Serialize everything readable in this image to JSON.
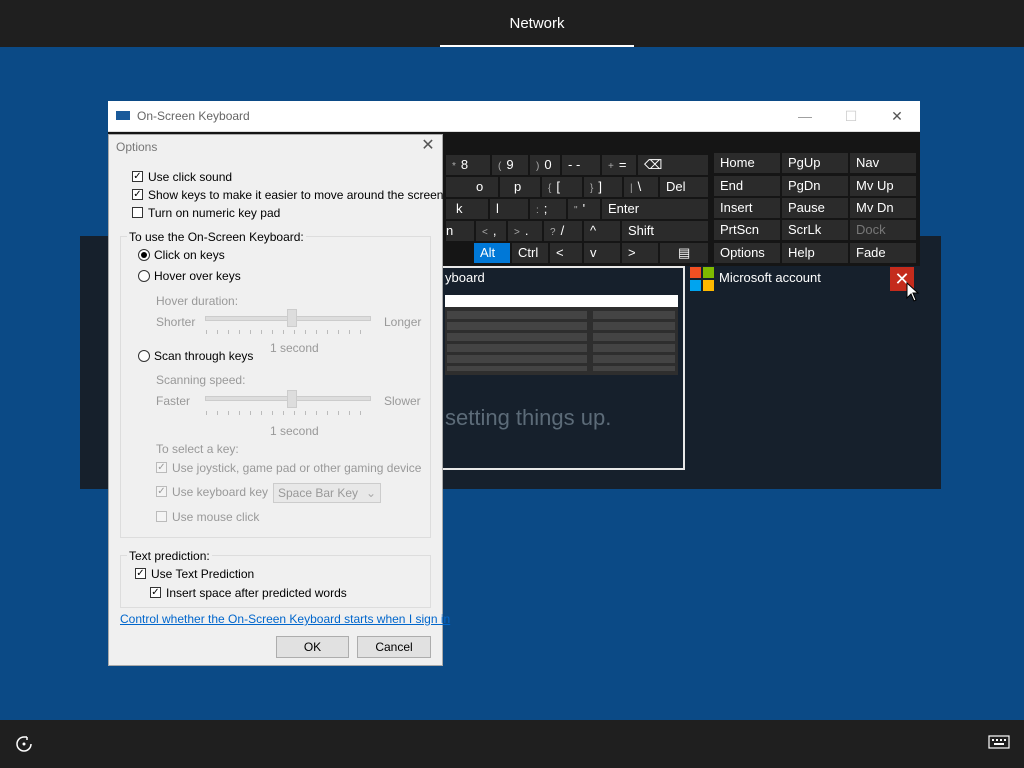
{
  "topbar": {
    "title": "Network"
  },
  "bottombar": {
    "ease_icon": "ease-of-access-icon",
    "keyboard_icon": "keyboard-icon"
  },
  "background": {
    "microsoft_account": "Microsoft account",
    "thumbnail_label": "yboard",
    "thumbnail_text": "setting things up."
  },
  "osk": {
    "title": "On-Screen Keyboard",
    "min": "—",
    "max": "☐",
    "close": "✕",
    "row1": [
      {
        "sub": "*",
        "main": "8"
      },
      {
        "sub": "(",
        "main": "9"
      },
      {
        "sub": ")",
        "main": "0"
      },
      {
        "sub": "",
        "main": "-  -"
      },
      {
        "sub": "+",
        "main": "="
      },
      {
        "sub": "",
        "main": "⌫"
      }
    ],
    "row2": [
      "o",
      "p",
      "[",
      "]",
      "\\",
      "Del"
    ],
    "row2_subs": [
      "{",
      "}",
      "|"
    ],
    "row3": [
      "k",
      "l",
      ";",
      "'",
      "Enter"
    ],
    "row3_subs": [
      ":",
      "\""
    ],
    "row4": [
      "n",
      "<",
      ",",
      ">",
      ".",
      "?",
      "/",
      "^",
      "Shift"
    ],
    "row5": [
      "Alt",
      "Ctrl",
      "<",
      "v",
      ">",
      "▤"
    ],
    "nav": [
      [
        "Home",
        "PgUp",
        "Nav"
      ],
      [
        "End",
        "PgDn",
        "Mv Up"
      ],
      [
        "Insert",
        "Pause",
        "Mv Dn"
      ],
      [
        "PrtScn",
        "ScrLk",
        "Dock"
      ],
      [
        "Options",
        "Help",
        "Fade"
      ]
    ]
  },
  "options": {
    "title": "Options",
    "close": "✕",
    "use_click_sound": "Use click sound",
    "show_keys": "Show keys to make it easier to move around the screen",
    "numeric_pad": "Turn on numeric key pad",
    "group_use": "To use the On-Screen Keyboard:",
    "click_on_keys": "Click on keys",
    "hover_over_keys": "Hover over keys",
    "hover_duration": "Hover duration:",
    "shorter": "Shorter",
    "longer": "Longer",
    "hover_value": "1 second",
    "scan_through": "Scan through keys",
    "scanning_speed": "Scanning speed:",
    "faster": "Faster",
    "slower": "Slower",
    "scan_value": "1 second",
    "to_select": "To select a key:",
    "use_joystick": "Use joystick, game pad or other gaming device",
    "use_keyboard_key": "Use keyboard key",
    "keyboard_key_value": "Space Bar Key",
    "use_mouse_click": "Use mouse click",
    "text_prediction": "Text prediction:",
    "use_text_prediction": "Use Text Prediction",
    "insert_space": "Insert space after predicted words",
    "link": "Control whether the On-Screen Keyboard starts when I sign in",
    "ok": "OK",
    "cancel": "Cancel",
    "check": "✓"
  }
}
